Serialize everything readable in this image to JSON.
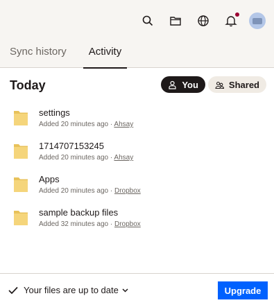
{
  "header": {
    "icons": [
      "search-icon",
      "folder-icon",
      "globe-icon",
      "bell-icon",
      "avatar"
    ],
    "notification_dot_color": "#9b0032"
  },
  "tabs": [
    {
      "label": "Sync history",
      "active": false
    },
    {
      "label": "Activity",
      "active": true
    }
  ],
  "activity": {
    "section_title": "Today",
    "filters": {
      "you": "You",
      "shared": "Shared"
    },
    "items": [
      {
        "name": "settings",
        "meta": "Added 20 minutes ago · ",
        "user": "Ahsay"
      },
      {
        "name": "1714707153245",
        "meta": "Added 20 minutes ago · ",
        "user": "Ahsay"
      },
      {
        "name": "Apps",
        "meta": "Added 20 minutes ago · ",
        "user": "Dropbox"
      },
      {
        "name": "sample backup files",
        "meta": "Added 32 minutes ago · ",
        "user": "Dropbox"
      }
    ]
  },
  "footer": {
    "status": "Your files are up to date",
    "upgrade": "Upgrade"
  },
  "colors": {
    "accent": "#0061fe",
    "folder": "#f5d57b",
    "top_bg": "#f7f5f2"
  }
}
